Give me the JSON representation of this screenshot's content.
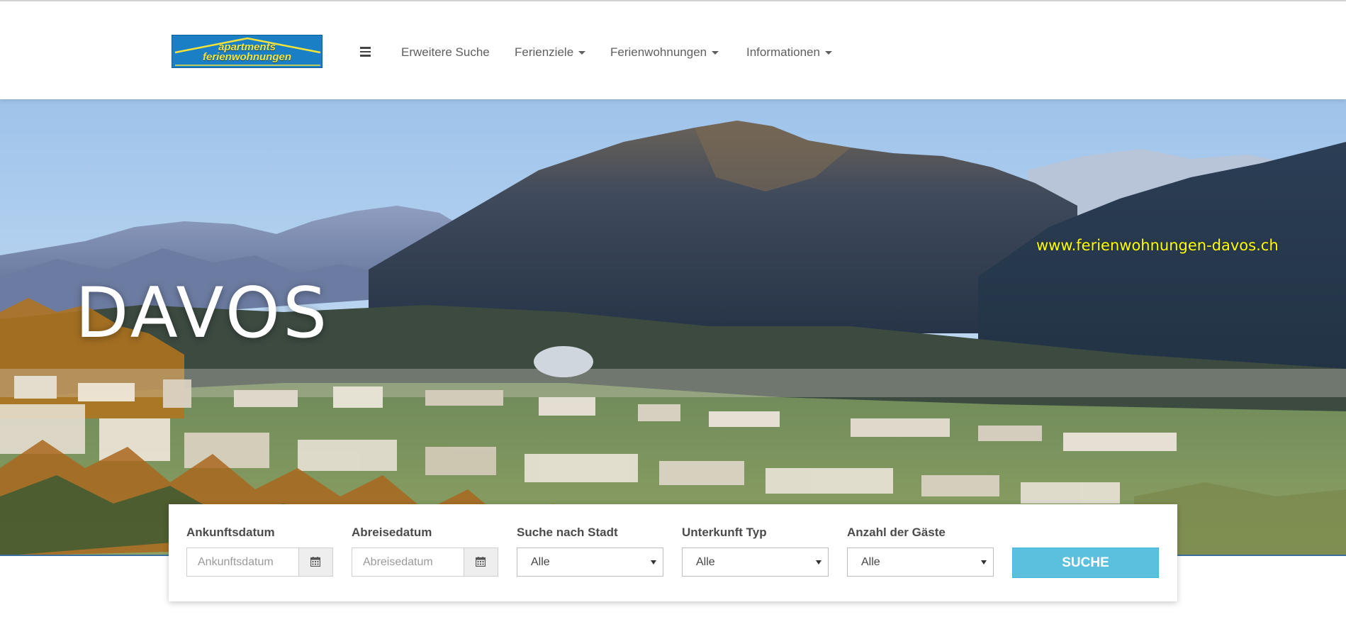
{
  "logo": {
    "line1": "apartments",
    "line2": "ferienwohnungen"
  },
  "nav": {
    "menu_icon": "hamburger-icon",
    "items": [
      {
        "label": "Erweitere Suche",
        "dropdown": false
      },
      {
        "label": "Ferienziele",
        "dropdown": true
      },
      {
        "label": "Ferienwohnungen",
        "dropdown": true
      },
      {
        "label": "Informationen",
        "dropdown": true
      }
    ]
  },
  "hero": {
    "title": "DAVOS",
    "url": "www.ferienwohnungen-davos.ch"
  },
  "search": {
    "arrival": {
      "label": "Ankunftsdatum",
      "placeholder": "Ankunftsdatum",
      "value": "",
      "icon": "calendar-icon"
    },
    "departure": {
      "label": "Abreisedatum",
      "placeholder": "Abreisedatum",
      "value": "",
      "icon": "calendar-icon"
    },
    "city": {
      "label": "Suche nach Stadt",
      "selected": "Alle"
    },
    "type": {
      "label": "Unterkunft Typ",
      "selected": "Alle"
    },
    "guests": {
      "label": "Anzahl der Gäste",
      "selected": "Alle"
    },
    "submit_label": "SUCHE"
  },
  "colors": {
    "accent_button": "#5bc0de",
    "logo_blue": "#1b7fc6",
    "logo_yellow": "#f3e43a",
    "url_yellow": "#ffff00",
    "nav_text": "#5f5f5f"
  }
}
